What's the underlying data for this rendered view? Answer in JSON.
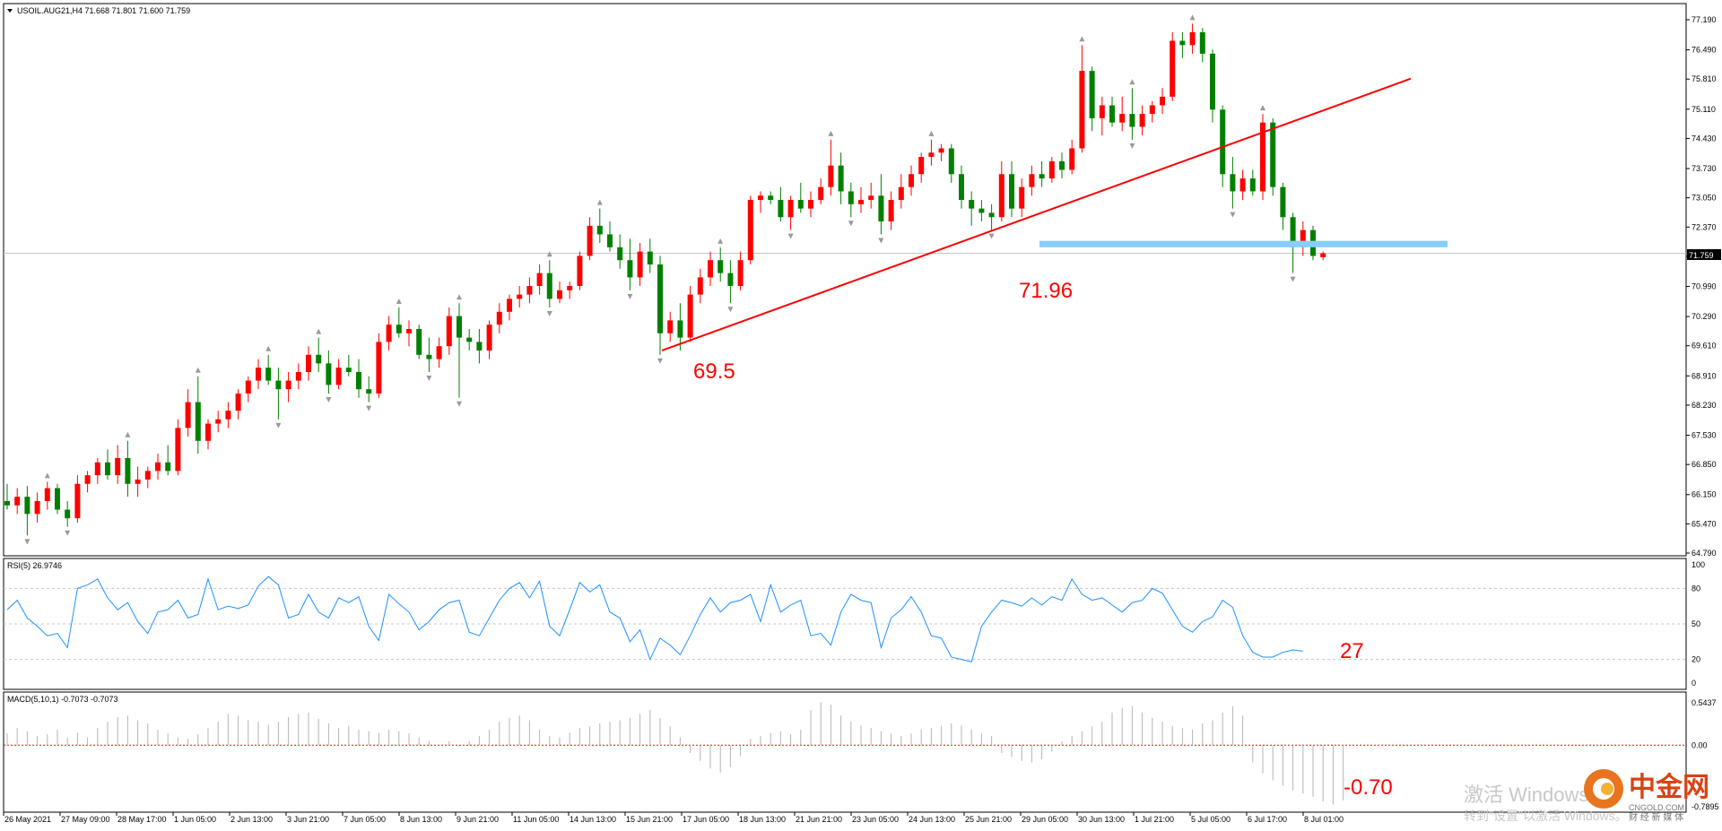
{
  "chart_data": {
    "type": "candlestick",
    "symbol_header": "USOIL.AUG21,H4  71.668 71.801 71.600 71.759",
    "current_price": 71.759,
    "current_price_label": "71.759",
    "colors": {
      "up": "#ff0000",
      "down": "#008000",
      "trendline": "#ff0000",
      "support": "#87cefa",
      "rsi": "#1e90ff",
      "macd": "#b4b4b4"
    },
    "price_axis_ticks": [
      "77.190",
      "76.490",
      "75.810",
      "75.110",
      "74.430",
      "73.730",
      "73.050",
      "72.370",
      "71.690",
      "70.990",
      "70.290",
      "69.610",
      "68.910",
      "68.230",
      "67.530",
      "66.850",
      "66.150",
      "65.470",
      "64.790"
    ],
    "price_range": [
      64.79,
      77.19
    ],
    "time_labels": [
      "26 May 2021",
      "27 May 09:00",
      "28 May 17:00",
      "1 Jun 05:00",
      "2 Jun 13:00",
      "3 Jun 21:00",
      "7 Jun 05:00",
      "8 Jun 13:00",
      "9 Jun 21:00",
      "11 Jun 05:00",
      "14 Jun 13:00",
      "15 Jun 21:00",
      "17 Jun 05:00",
      "18 Jun 13:00",
      "21 Jun 21:00",
      "23 Jun 05:00",
      "24 Jun 13:00",
      "25 Jun 21:00",
      "29 Jun 05:00",
      "30 Jun 13:00",
      "1 Jul 21:00",
      "5 Jul 05:00",
      "6 Jul 17:00",
      "8 Jul 01:00"
    ],
    "candles": [
      [
        66.0,
        66.4,
        65.8,
        65.9
      ],
      [
        65.9,
        66.3,
        65.7,
        66.1
      ],
      [
        66.1,
        66.35,
        65.2,
        65.7
      ],
      [
        65.7,
        66.2,
        65.5,
        66.0
      ],
      [
        66.0,
        66.45,
        65.8,
        66.3
      ],
      [
        66.3,
        66.4,
        65.7,
        65.8
      ],
      [
        65.8,
        66.0,
        65.4,
        65.6
      ],
      [
        65.6,
        66.6,
        65.5,
        66.4
      ],
      [
        66.4,
        66.7,
        66.2,
        66.6
      ],
      [
        66.6,
        67.0,
        66.4,
        66.9
      ],
      [
        66.9,
        67.2,
        66.5,
        66.6
      ],
      [
        66.6,
        67.3,
        66.4,
        67.0
      ],
      [
        67.0,
        67.4,
        66.1,
        66.4
      ],
      [
        66.4,
        66.8,
        66.1,
        66.5
      ],
      [
        66.5,
        66.8,
        66.3,
        66.7
      ],
      [
        66.7,
        67.1,
        66.5,
        66.9
      ],
      [
        66.9,
        67.3,
        66.6,
        66.7
      ],
      [
        66.7,
        67.9,
        66.6,
        67.7
      ],
      [
        67.7,
        68.6,
        67.5,
        68.3
      ],
      [
        68.3,
        68.9,
        67.1,
        67.4
      ],
      [
        67.4,
        67.9,
        67.2,
        67.8
      ],
      [
        67.8,
        68.1,
        67.6,
        67.9
      ],
      [
        67.9,
        68.3,
        67.7,
        68.1
      ],
      [
        68.1,
        68.6,
        67.9,
        68.5
      ],
      [
        68.5,
        68.9,
        68.3,
        68.8
      ],
      [
        68.8,
        69.3,
        68.6,
        69.1
      ],
      [
        69.1,
        69.4,
        68.7,
        68.8
      ],
      [
        68.8,
        69.1,
        67.9,
        68.6
      ],
      [
        68.6,
        69.0,
        68.3,
        68.8
      ],
      [
        68.8,
        69.2,
        68.6,
        69.0
      ],
      [
        69.0,
        69.6,
        68.8,
        69.4
      ],
      [
        69.4,
        69.8,
        69.0,
        69.2
      ],
      [
        69.2,
        69.5,
        68.5,
        68.7
      ],
      [
        68.7,
        69.3,
        68.6,
        69.1
      ],
      [
        69.1,
        69.4,
        68.9,
        69.0
      ],
      [
        69.0,
        69.3,
        68.4,
        68.6
      ],
      [
        68.6,
        68.9,
        68.3,
        68.5
      ],
      [
        68.5,
        69.9,
        68.4,
        69.7
      ],
      [
        69.7,
        70.3,
        69.5,
        70.1
      ],
      [
        70.1,
        70.5,
        69.8,
        69.9
      ],
      [
        69.9,
        70.2,
        69.6,
        70.0
      ],
      [
        70.0,
        70.1,
        69.3,
        69.4
      ],
      [
        69.4,
        69.8,
        69.0,
        69.3
      ],
      [
        69.3,
        69.8,
        69.1,
        69.6
      ],
      [
        69.6,
        70.5,
        69.4,
        70.3
      ],
      [
        70.3,
        70.6,
        68.4,
        69.8
      ],
      [
        69.8,
        70.0,
        69.5,
        69.7
      ],
      [
        69.7,
        70.0,
        69.2,
        69.5
      ],
      [
        69.5,
        70.2,
        69.3,
        70.1
      ],
      [
        70.1,
        70.6,
        69.9,
        70.4
      ],
      [
        70.4,
        70.8,
        70.2,
        70.7
      ],
      [
        70.7,
        71.0,
        70.5,
        70.8
      ],
      [
        70.8,
        71.2,
        70.6,
        71.0
      ],
      [
        71.0,
        71.5,
        70.8,
        71.3
      ],
      [
        71.3,
        71.6,
        70.5,
        70.7
      ],
      [
        70.7,
        71.1,
        70.6,
        70.9
      ],
      [
        70.9,
        71.1,
        70.7,
        71.0
      ],
      [
        71.0,
        71.8,
        70.9,
        71.7
      ],
      [
        71.7,
        72.6,
        71.6,
        72.4
      ],
      [
        72.4,
        72.8,
        72.0,
        72.2
      ],
      [
        72.2,
        72.5,
        71.8,
        71.9
      ],
      [
        71.9,
        72.2,
        71.4,
        71.6
      ],
      [
        71.6,
        72.1,
        70.9,
        71.2
      ],
      [
        71.2,
        72.0,
        71.0,
        71.8
      ],
      [
        71.8,
        72.1,
        71.3,
        71.5
      ],
      [
        71.5,
        71.7,
        69.4,
        69.9
      ],
      [
        69.9,
        70.4,
        69.7,
        70.2
      ],
      [
        70.2,
        70.6,
        69.5,
        69.8
      ],
      [
        69.8,
        71.0,
        69.7,
        70.8
      ],
      [
        70.8,
        71.4,
        70.6,
        71.2
      ],
      [
        71.2,
        71.8,
        71.0,
        71.6
      ],
      [
        71.6,
        71.9,
        71.1,
        71.3
      ],
      [
        71.3,
        71.6,
        70.6,
        71.0
      ],
      [
        71.0,
        71.8,
        70.9,
        71.6
      ],
      [
        71.6,
        73.1,
        71.5,
        73.0
      ],
      [
        73.0,
        73.2,
        72.7,
        73.1
      ],
      [
        73.1,
        73.2,
        72.9,
        73.0
      ],
      [
        73.0,
        73.3,
        72.5,
        72.6
      ],
      [
        72.6,
        73.1,
        72.3,
        73.0
      ],
      [
        73.0,
        73.4,
        72.7,
        72.8
      ],
      [
        72.8,
        73.2,
        72.6,
        73.0
      ],
      [
        73.0,
        73.5,
        72.9,
        73.3
      ],
      [
        73.3,
        74.4,
        73.1,
        73.8
      ],
      [
        73.8,
        74.1,
        72.9,
        73.2
      ],
      [
        73.2,
        73.4,
        72.6,
        72.9
      ],
      [
        72.9,
        73.3,
        72.7,
        73.0
      ],
      [
        73.0,
        73.4,
        72.8,
        73.1
      ],
      [
        73.1,
        73.6,
        72.2,
        72.5
      ],
      [
        72.5,
        73.2,
        72.3,
        73.0
      ],
      [
        73.0,
        73.6,
        72.8,
        73.3
      ],
      [
        73.3,
        73.8,
        73.1,
        73.6
      ],
      [
        73.6,
        74.1,
        73.4,
        74.0
      ],
      [
        74.0,
        74.4,
        73.8,
        74.1
      ],
      [
        74.1,
        74.3,
        73.9,
        74.2
      ],
      [
        74.2,
        74.3,
        73.4,
        73.6
      ],
      [
        73.6,
        73.8,
        72.8,
        73.0
      ],
      [
        73.0,
        73.2,
        72.4,
        72.8
      ],
      [
        72.8,
        73.0,
        72.5,
        72.7
      ],
      [
        72.7,
        72.9,
        72.3,
        72.6
      ],
      [
        72.6,
        73.9,
        72.5,
        73.6
      ],
      [
        73.6,
        73.9,
        72.6,
        72.8
      ],
      [
        72.8,
        73.5,
        72.6,
        73.3
      ],
      [
        73.3,
        73.8,
        73.1,
        73.6
      ],
      [
        73.6,
        73.9,
        73.3,
        73.5
      ],
      [
        73.5,
        74.0,
        73.4,
        73.9
      ],
      [
        73.9,
        74.1,
        73.5,
        73.7
      ],
      [
        73.7,
        74.4,
        73.6,
        74.2
      ],
      [
        74.2,
        76.6,
        74.1,
        76.0
      ],
      [
        76.0,
        76.1,
        74.6,
        74.9
      ],
      [
        74.9,
        75.4,
        74.5,
        75.2
      ],
      [
        75.2,
        75.4,
        74.7,
        74.8
      ],
      [
        74.8,
        75.4,
        74.6,
        75.0
      ],
      [
        75.0,
        75.6,
        74.4,
        74.7
      ],
      [
        74.7,
        75.2,
        74.5,
        75.0
      ],
      [
        75.0,
        75.3,
        74.8,
        75.2
      ],
      [
        75.2,
        75.6,
        75.0,
        75.4
      ],
      [
        75.4,
        76.9,
        75.3,
        76.7
      ],
      [
        76.7,
        76.9,
        76.3,
        76.6
      ],
      [
        76.6,
        77.1,
        76.4,
        76.9
      ],
      [
        76.9,
        77.0,
        76.2,
        76.4
      ],
      [
        76.4,
        76.5,
        74.8,
        75.1
      ],
      [
        75.1,
        75.2,
        73.3,
        73.6
      ],
      [
        73.6,
        74.0,
        72.8,
        73.2
      ],
      [
        73.2,
        73.7,
        73.0,
        73.5
      ],
      [
        73.5,
        73.7,
        73.1,
        73.2
      ],
      [
        73.2,
        75.0,
        73.0,
        74.8
      ],
      [
        74.8,
        74.9,
        73.1,
        73.3
      ],
      [
        73.3,
        73.4,
        72.3,
        72.6
      ],
      [
        72.6,
        72.7,
        71.3,
        71.9
      ],
      [
        71.9,
        72.5,
        71.7,
        72.3
      ],
      [
        72.3,
        72.4,
        71.6,
        71.7
      ],
      [
        71.668,
        71.801,
        71.6,
        71.759
      ]
    ],
    "annotations": [
      {
        "text": "69.5",
        "price": 69.5
      },
      {
        "text": "71.96",
        "price": 71.96
      }
    ],
    "trendline": {
      "from_price": 69.5,
      "to_price": 75.82
    },
    "support_zone": {
      "low": 71.9,
      "high": 72.05
    },
    "rsi": {
      "header": "RSI(5) 26.9746",
      "levels": [
        100,
        80,
        50,
        20,
        0
      ],
      "level_labels": [
        "100",
        "80",
        "50",
        "20",
        "0"
      ],
      "values": [
        62,
        70,
        55,
        48,
        40,
        42,
        30,
        80,
        83,
        88,
        72,
        62,
        68,
        52,
        42,
        60,
        62,
        70,
        55,
        58,
        88,
        62,
        65,
        63,
        66,
        82,
        90,
        83,
        55,
        58,
        75,
        60,
        55,
        72,
        68,
        73,
        48,
        36,
        75,
        67,
        60,
        45,
        52,
        62,
        68,
        70,
        43,
        40,
        55,
        70,
        80,
        85,
        72,
        86,
        48,
        40,
        62,
        85,
        77,
        83,
        60,
        55,
        35,
        45,
        20,
        38,
        32,
        24,
        40,
        58,
        72,
        60,
        68,
        70,
        75,
        52,
        83,
        60,
        66,
        70,
        40,
        42,
        32,
        60,
        75,
        70,
        68,
        30,
        55,
        62,
        73,
        60,
        40,
        38,
        22,
        20,
        18,
        48,
        60,
        70,
        68,
        65,
        72,
        66,
        73,
        70,
        88,
        75,
        70,
        72,
        66,
        60,
        68,
        70,
        80,
        76,
        62,
        48,
        43,
        52,
        56,
        70,
        64,
        40,
        26,
        22,
        22,
        26,
        28,
        27
      ],
      "annotation": "27"
    },
    "macd": {
      "header": "MACD(5,10,1) -0.7073 -0.7073",
      "axis_labels": [
        "0.5437",
        "0.00",
        "-0.7895"
      ],
      "range": [
        -0.7895,
        0.5437
      ],
      "annotation": "-0.70",
      "values": [
        0.15,
        0.22,
        0.18,
        0.12,
        0.14,
        0.2,
        0.1,
        0.16,
        0.1,
        0.22,
        0.3,
        0.36,
        0.38,
        0.32,
        0.28,
        0.2,
        0.15,
        0.1,
        0.08,
        0.14,
        0.22,
        0.3,
        0.4,
        0.38,
        0.32,
        0.3,
        0.26,
        0.3,
        0.36,
        0.4,
        0.42,
        0.34,
        0.28,
        0.22,
        0.25,
        0.2,
        0.18,
        0.16,
        0.2,
        0.18,
        0.15,
        0.1,
        0.05,
        0.0,
        0.05,
        -0.02,
        0.05,
        0.12,
        0.2,
        0.3,
        0.35,
        0.38,
        0.32,
        0.2,
        0.12,
        0.1,
        0.16,
        0.22,
        0.24,
        0.28,
        0.3,
        0.32,
        0.35,
        0.4,
        0.45,
        0.35,
        0.24,
        0.1,
        -0.1,
        -0.2,
        -0.3,
        -0.35,
        -0.28,
        -0.14,
        0.08,
        0.12,
        0.16,
        0.18,
        0.14,
        0.2,
        0.45,
        0.55,
        0.52,
        0.38,
        0.3,
        0.25,
        0.22,
        0.18,
        0.15,
        0.12,
        0.15,
        0.2,
        0.22,
        0.25,
        0.28,
        0.25,
        0.2,
        0.15,
        0.12,
        -0.1,
        -0.15,
        -0.2,
        -0.22,
        -0.18,
        -0.08,
        0.05,
        0.12,
        0.18,
        0.24,
        0.3,
        0.42,
        0.48,
        0.5,
        0.42,
        0.35,
        0.3,
        0.25,
        0.22,
        0.2,
        0.28,
        0.32,
        0.42,
        0.5,
        0.38,
        -0.22,
        -0.36,
        -0.45,
        -0.52,
        -0.58,
        -0.62,
        -0.66,
        -0.72,
        -0.76,
        -0.7073
      ]
    }
  },
  "watermarks": {
    "activate_line1": "激活 Windows",
    "activate_line2": "转到\"设置\"以激活 Windows。",
    "brand_cn": "中金网",
    "brand_url": "CNGOLD.COM",
    "brand_tag": "财 经 新 媒 体"
  }
}
